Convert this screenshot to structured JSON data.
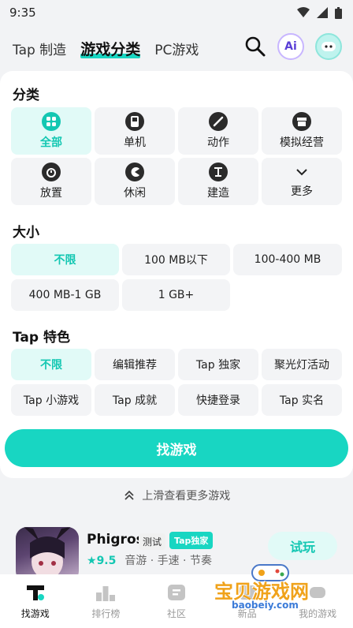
{
  "status": {
    "time": "9:35"
  },
  "top_nav": {
    "tabs": [
      "Tap 制造",
      "游戏分类",
      "PC游戏"
    ],
    "ai_label": "Ai"
  },
  "sections": {
    "category": {
      "title": "分类",
      "items": [
        "全部",
        "单机",
        "动作",
        "模拟经营",
        "放置",
        "休闲",
        "建造",
        "更多"
      ]
    },
    "size": {
      "title": "大小",
      "items": [
        "不限",
        "100 MB以下",
        "100-400 MB",
        "400 MB-1 GB",
        "1 GB+"
      ]
    },
    "feature": {
      "title": "Tap 特色",
      "items": [
        "不限",
        "编辑推荐",
        "Tap 独家",
        "聚光灯活动",
        "Tap 小游戏",
        "Tap 成就",
        "快捷登录",
        "Tap 实名"
      ]
    }
  },
  "find_button": "找游戏",
  "swipe_hint": "上滑查看更多游戏",
  "game": {
    "name": "Phigros",
    "badge_test": "测试",
    "badge_tap": "Tap独家",
    "score": "9.5",
    "tags": "音游 · 手速 · 节奏",
    "try_label": "试玩"
  },
  "bottom_tabs": [
    "找游戏",
    "排行榜",
    "社区",
    "新品",
    "我的游戏"
  ],
  "watermark": {
    "text": "宝贝游戏网",
    "url": "baobeiy.com"
  },
  "colors": {
    "accent": "#18d6c2",
    "active_bg": "#e1faf7"
  }
}
